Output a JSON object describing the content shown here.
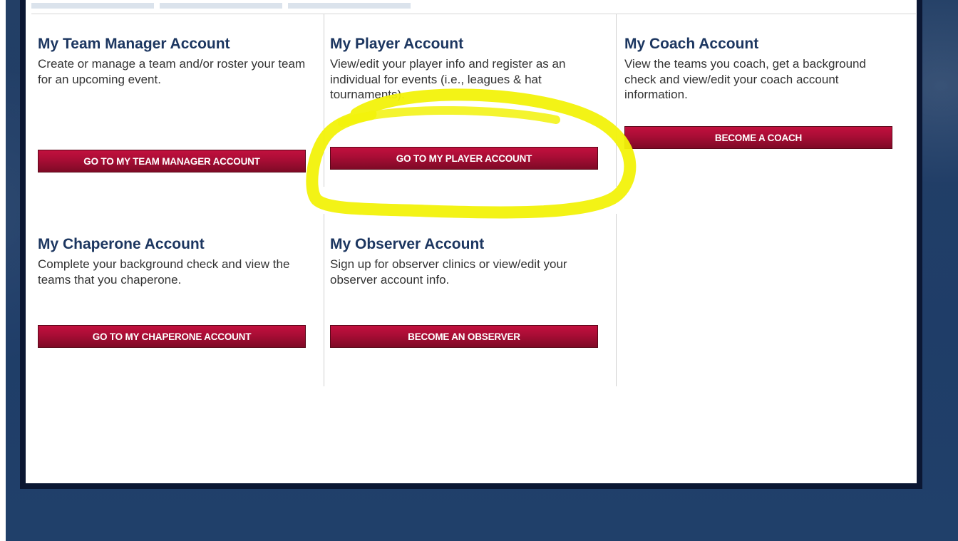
{
  "cards": [
    {
      "title": "My Team Manager Account",
      "description": "Create or manage a team and/or roster your team for an upcoming event.",
      "button": "GO TO MY TEAM MANAGER ACCOUNT"
    },
    {
      "title": "My Player Account",
      "description": "View/edit your player info and register as an individual for events (i.e., leagues & hat tournaments).",
      "button": "GO TO MY PLAYER ACCOUNT"
    },
    {
      "title": "My Coach Account",
      "description": "View the teams you coach, get a background check and view/edit your coach account information.",
      "button": "BECOME A COACH"
    },
    {
      "title": "My Chaperone Account",
      "description": "Complete your background check and view the teams that you chaperone.",
      "button": "GO TO MY CHAPERONE ACCOUNT"
    },
    {
      "title": "My Observer Account",
      "description": "Sign up for observer clinics or view/edit your observer account info.",
      "button": "BECOME AN OBSERVER"
    }
  ],
  "colors": {
    "heading": "#1c3660",
    "button": "#a80d35",
    "highlight": "#f2f20a",
    "background": "#20406a"
  }
}
